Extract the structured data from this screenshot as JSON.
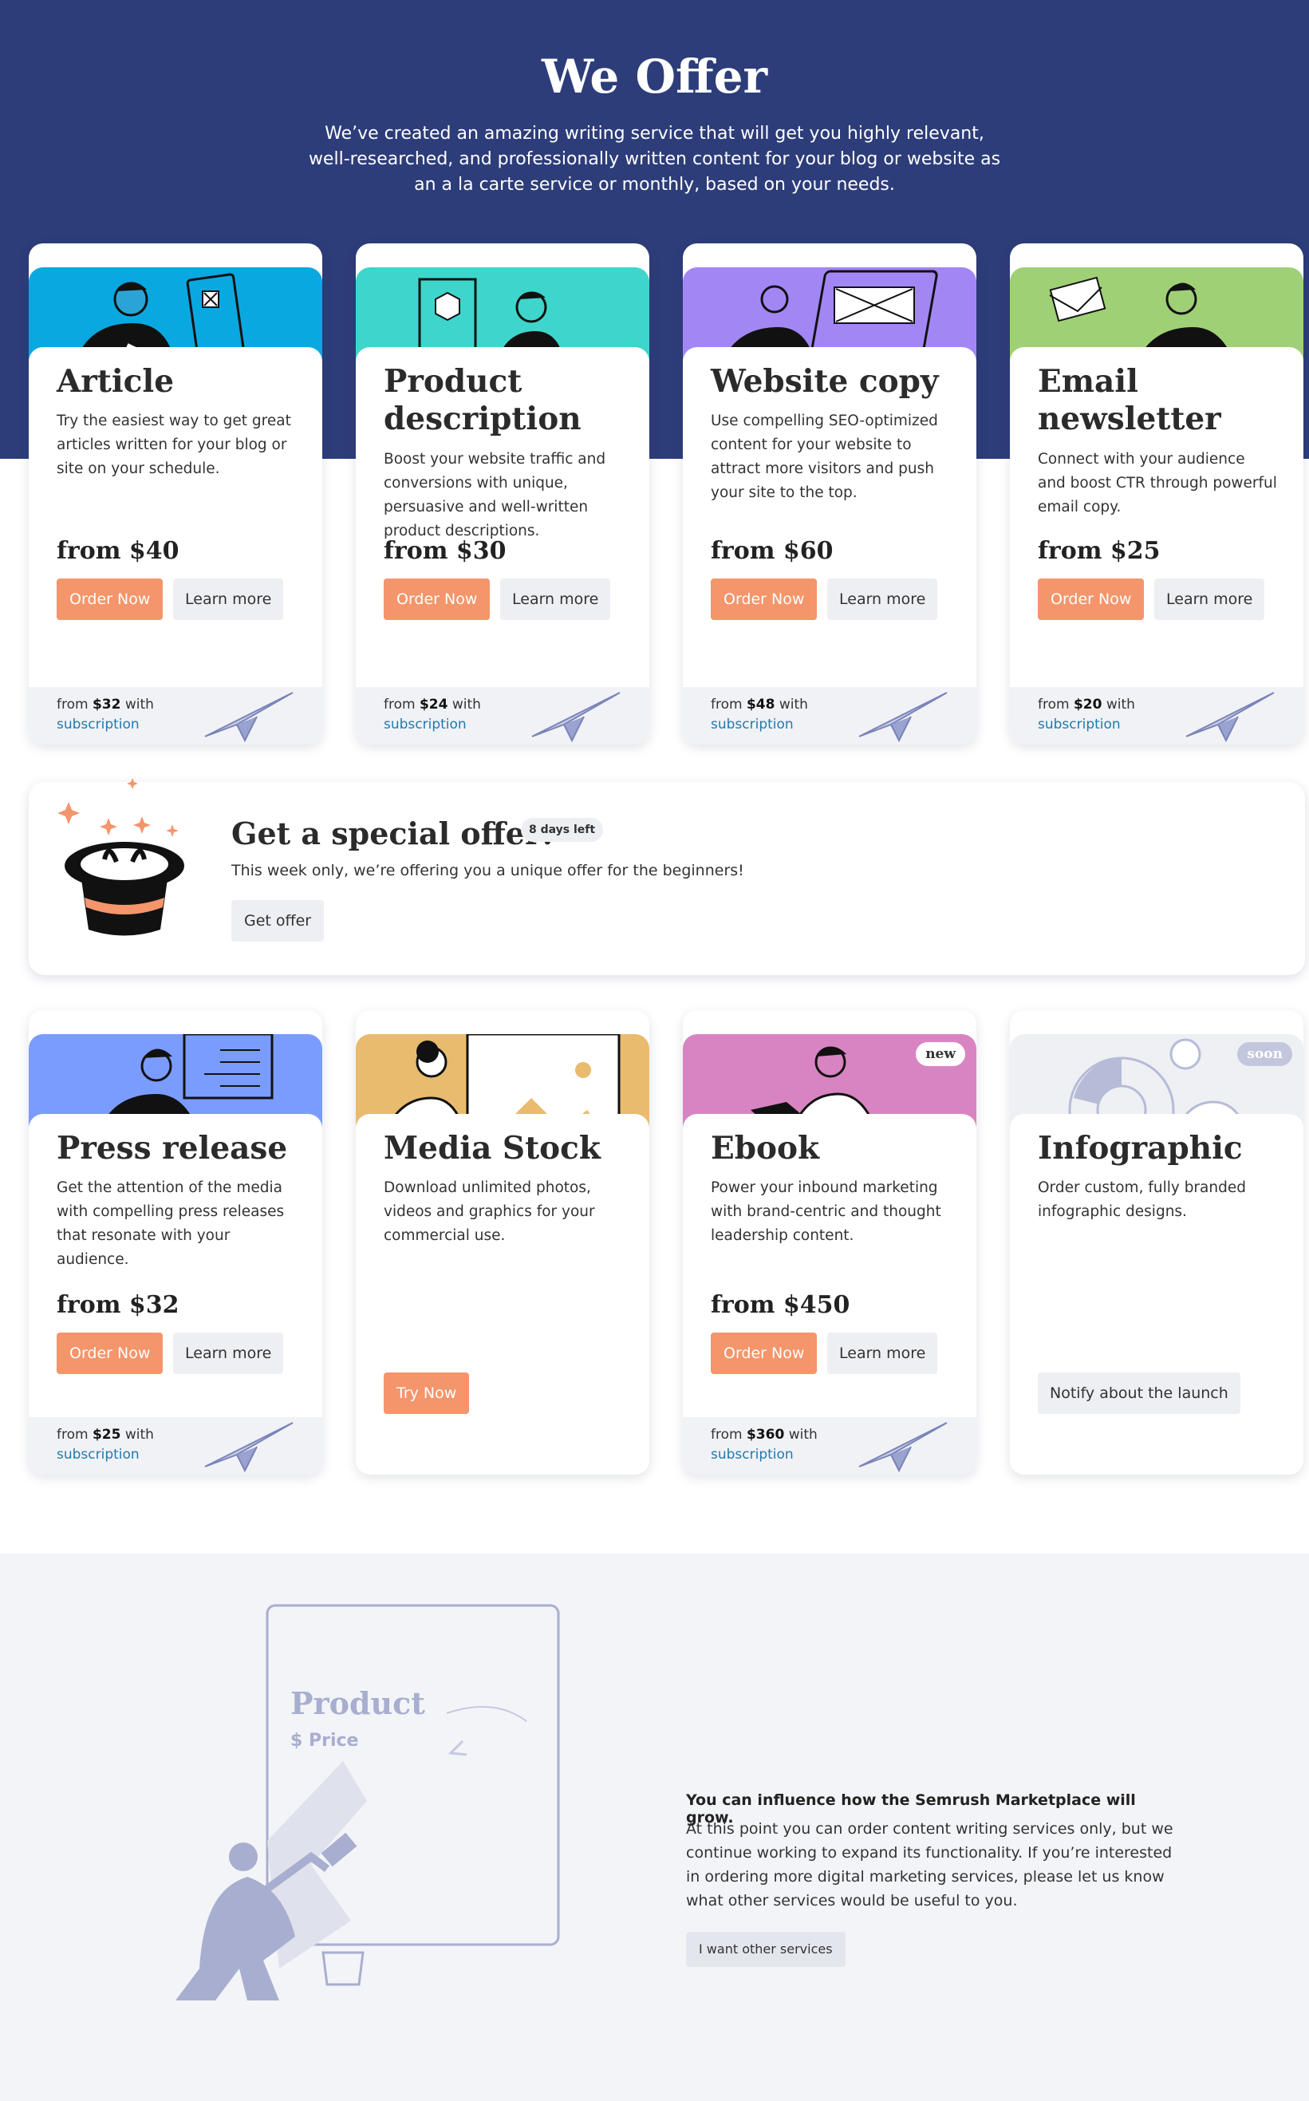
{
  "hero": {
    "title": "We Offer",
    "subtitle": "We’ve created an amazing writing service that will get you highly relevant, well-researched, and professionally written content for your blog or website as an a la carte service or monthly, based on your needs."
  },
  "colors": {
    "hero_bg": "#2d3d7a",
    "order_button": "#f4956b",
    "link": "#1e7ab0",
    "article": "#0aa8e0",
    "product": "#3ed6cc",
    "website": "#a287f4",
    "email": "#9fd076",
    "press": "#7b9cff",
    "media": "#e8bb6e",
    "ebook": "#d984c2",
    "infographic": "#eff0f4"
  },
  "cards_row1": [
    {
      "title": "Article",
      "desc": "Try the easiest way to get great articles written for your blog or site on your schedule.",
      "price": "from $40",
      "order": "Order Now",
      "learn": "Learn more",
      "sub_prefix": "from",
      "sub_price": "$32",
      "sub_with": "with",
      "sub_link": "subscription"
    },
    {
      "title": "Product description",
      "desc": "Boost your website traffic and conversions with unique, persuasive and well-written product descriptions.",
      "price": "from $30",
      "order": "Order Now",
      "learn": "Learn more",
      "sub_prefix": "from",
      "sub_price": "$24",
      "sub_with": "with",
      "sub_link": "subscription"
    },
    {
      "title": "Website copy",
      "desc": "Use compelling SEO-optimized content for your website to attract more visitors and push your site to the top.",
      "price": "from $60",
      "order": "Order Now",
      "learn": "Learn more",
      "sub_prefix": "from",
      "sub_price": "$48",
      "sub_with": "with",
      "sub_link": "subscription"
    },
    {
      "title": "Email newsletter",
      "desc": "Connect with your audience and boost CTR through powerful email copy.",
      "price": "from $25",
      "order": "Order Now",
      "learn": "Learn more",
      "sub_prefix": "from",
      "sub_price": "$20",
      "sub_with": "with",
      "sub_link": "subscription"
    }
  ],
  "special": {
    "title": "Get a special offer!",
    "badge": "8 days left",
    "desc": "This week only, we’re offering you a unique offer for the beginners!",
    "button": "Get offer"
  },
  "cards_row2": [
    {
      "title": "Press release",
      "desc": "Get the attention of the media with compelling press releases that resonate with your audience.",
      "price": "from $32",
      "order": "Order Now",
      "learn": "Learn more",
      "sub_prefix": "from",
      "sub_price": "$25",
      "sub_with": "with",
      "sub_link": "subscription"
    },
    {
      "title": "Media Stock",
      "desc": "Download unlimited photos, videos and graphics for your commercial use.",
      "button": "Try Now"
    },
    {
      "title": "Ebook",
      "badge": "new",
      "desc": "Power your inbound marketing with brand-centric and thought leadership content.",
      "price": "from $450",
      "order": "Order Now",
      "learn": "Learn more",
      "sub_prefix": "from",
      "sub_price": "$360",
      "sub_with": "with",
      "sub_link": "subscription"
    },
    {
      "title": "Infographic",
      "badge": "soon",
      "desc": "Order custom, fully branded infographic designs.",
      "button": "Notify about the launch"
    }
  ],
  "bottom": {
    "mock_title": "Product",
    "mock_price": "$ Price",
    "heading": "You can influence how the Semrush Marketplace will grow.",
    "text": "At this point you can order content writing services only, but we continue working to expand its functionality. If you’re interested in ordering more digital marketing services, please let us know what other services would be useful to you.",
    "button": "I want other services"
  }
}
